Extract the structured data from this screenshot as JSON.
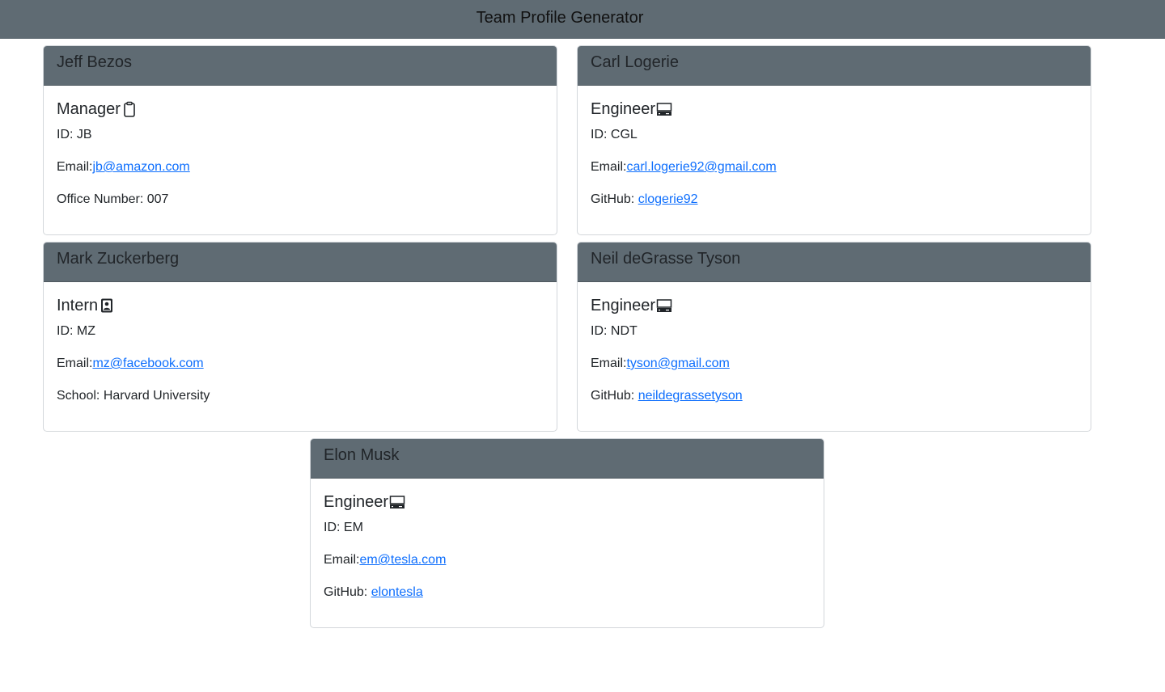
{
  "header": {
    "title": "Team Profile Generator"
  },
  "cards": [
    {
      "name": "Jeff Bezos",
      "role": "Manager",
      "role_icon": "clipboard-icon",
      "id_label": "ID: JB",
      "email_label": "Email:",
      "email": "jb@amazon.com",
      "extra_label": "Office Number: 007",
      "extra_link": ""
    },
    {
      "name": "Carl Logerie",
      "role": "Engineer",
      "role_icon": "computer-icon",
      "id_label": "ID: CGL",
      "email_label": "Email:",
      "email": "carl.logerie92@gmail.com",
      "extra_label": "GitHub: ",
      "extra_link": "clogerie92"
    },
    {
      "name": "Mark Zuckerberg",
      "role": "Intern",
      "role_icon": "id-badge-icon",
      "id_label": "ID: MZ",
      "email_label": "Email:",
      "email": "mz@facebook.com",
      "extra_label": "School: Harvard University",
      "extra_link": ""
    },
    {
      "name": "Neil deGrasse Tyson",
      "role": "Engineer",
      "role_icon": "computer-icon",
      "id_label": "ID: NDT",
      "email_label": "Email:",
      "email": "tyson@gmail.com",
      "extra_label": "GitHub: ",
      "extra_link": "neildegrassetyson"
    },
    {
      "name": "Elon Musk",
      "role": "Engineer",
      "role_icon": "computer-icon",
      "id_label": "ID: EM",
      "email_label": "Email:",
      "email": "em@tesla.com",
      "extra_label": "GitHub: ",
      "extra_link": "elontesla"
    }
  ]
}
